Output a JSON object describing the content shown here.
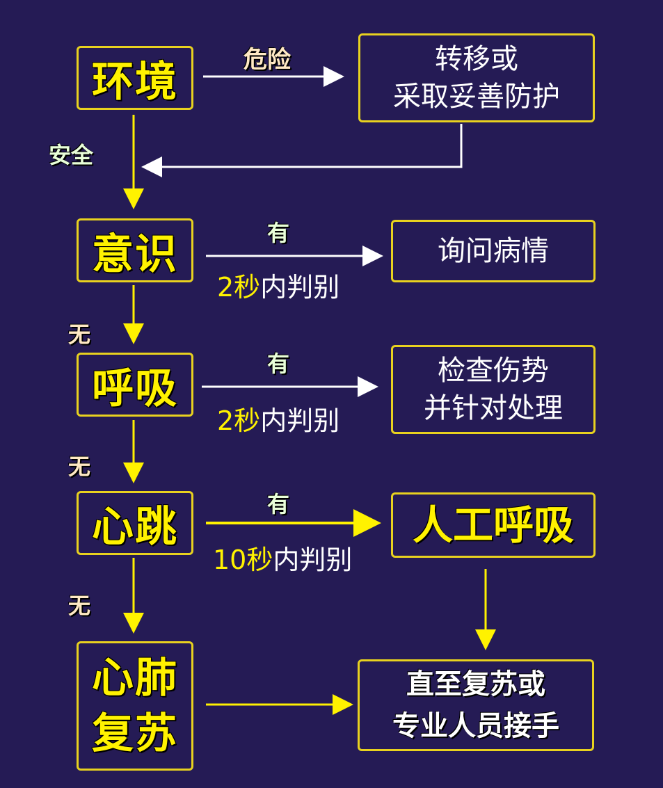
{
  "steps": {
    "environment": "环境",
    "consciousness": "意识",
    "breathing": "呼吸",
    "heartbeat": "心跳",
    "cpr_line1": "心肺",
    "cpr_line2": "复苏"
  },
  "outcomes": {
    "move_line1": "转移或",
    "move_line2": "采取妥善防护",
    "ask": "询问病情",
    "check_line1": "检查伤势",
    "check_line2": "并针对处理",
    "artificial_breathing": "人工呼吸",
    "until_line1": "直至复苏或",
    "until_line2": "专业人员接手"
  },
  "labels": {
    "danger": "危险",
    "safe": "安全",
    "yes": "有",
    "no": "无"
  },
  "notes": {
    "two_sec_num": "2秒",
    "two_sec_rest": "内判别",
    "ten_sec_num": "10秒",
    "ten_sec_rest": "内判别"
  },
  "colors": {
    "background": "#251b55",
    "step_text": "#fff200",
    "box_border": "#e8d21f",
    "yes_arrow": "#fff200",
    "flow_arrow": "#ffffff"
  }
}
